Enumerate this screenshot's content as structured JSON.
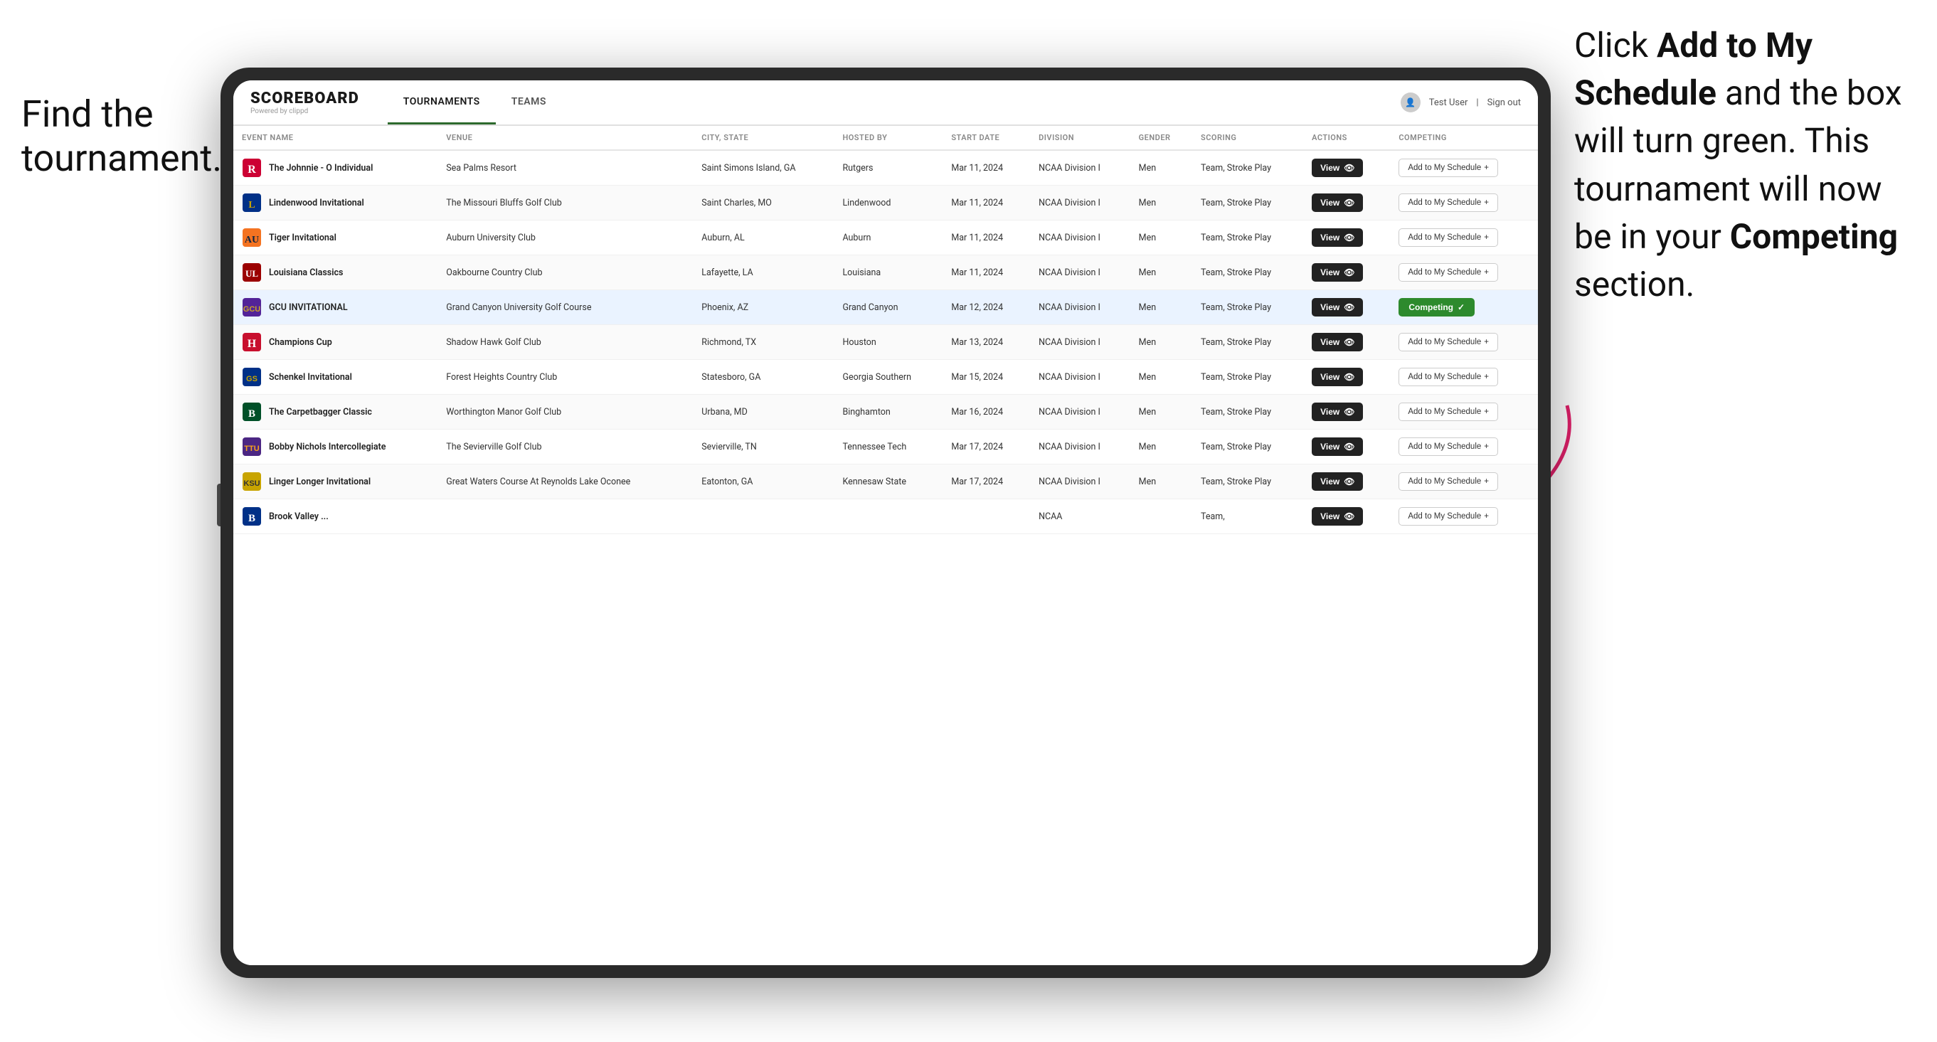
{
  "annotations": {
    "left": "Find the\ntournament.",
    "right_line1": "Click ",
    "right_bold1": "Add to My\nSchedule",
    "right_line2": " and the\nbox will turn green.\nThis tournament\nwill now be in\nyour ",
    "right_bold2": "Competing",
    "right_line3": "\nsection."
  },
  "navbar": {
    "logo": "SCOREBOARD",
    "logo_sub": "Powered by clippd",
    "tabs": [
      "TOURNAMENTS",
      "TEAMS"
    ],
    "active_tab": "TOURNAMENTS",
    "user": "Test User",
    "sign_out": "Sign out"
  },
  "table": {
    "columns": [
      "EVENT NAME",
      "VENUE",
      "CITY, STATE",
      "HOSTED BY",
      "START DATE",
      "DIVISION",
      "GENDER",
      "SCORING",
      "ACTIONS",
      "COMPETING"
    ],
    "rows": [
      {
        "logo": "🅁",
        "logo_color": "#c8102e",
        "event": "The Johnnie - O Individual",
        "venue": "Sea Palms Resort",
        "city_state": "Saint Simons Island, GA",
        "hosted_by": "Rutgers",
        "start_date": "Mar 11, 2024",
        "division": "NCAA Division I",
        "gender": "Men",
        "scoring": "Team, Stroke Play",
        "action": "View",
        "competing": "Add to My Schedule +",
        "is_competing": false,
        "highlighted": false
      },
      {
        "logo": "🦁",
        "logo_color": "#003087",
        "event": "Lindenwood Invitational",
        "venue": "The Missouri Bluffs Golf Club",
        "city_state": "Saint Charles, MO",
        "hosted_by": "Lindenwood",
        "start_date": "Mar 11, 2024",
        "division": "NCAA Division I",
        "gender": "Men",
        "scoring": "Team, Stroke Play",
        "action": "View",
        "competing": "Add to My Schedule +",
        "is_competing": false,
        "highlighted": false
      },
      {
        "logo": "🐯",
        "logo_color": "#f47321",
        "event": "Tiger Invitational",
        "venue": "Auburn University Club",
        "city_state": "Auburn, AL",
        "hosted_by": "Auburn",
        "start_date": "Mar 11, 2024",
        "division": "NCAA Division I",
        "gender": "Men",
        "scoring": "Team, Stroke Play",
        "action": "View",
        "competing": "Add to My Schedule +",
        "is_competing": false,
        "highlighted": false
      },
      {
        "logo": "⚜",
        "logo_color": "#8b0000",
        "event": "Louisiana Classics",
        "venue": "Oakbourne Country Club",
        "city_state": "Lafayette, LA",
        "hosted_by": "Louisiana",
        "start_date": "Mar 11, 2024",
        "division": "NCAA Division I",
        "gender": "Men",
        "scoring": "Team, Stroke Play",
        "action": "View",
        "competing": "Add to My Schedule +",
        "is_competing": false,
        "highlighted": false
      },
      {
        "logo": "⛰",
        "logo_color": "#522398",
        "event": "GCU INVITATIONAL",
        "venue": "Grand Canyon University Golf Course",
        "city_state": "Phoenix, AZ",
        "hosted_by": "Grand Canyon",
        "start_date": "Mar 12, 2024",
        "division": "NCAA Division I",
        "gender": "Men",
        "scoring": "Team, Stroke Play",
        "action": "View",
        "competing": "Competing ✓",
        "is_competing": true,
        "highlighted": true
      },
      {
        "logo": "⚙",
        "logo_color": "#c8102e",
        "event": "Champions Cup",
        "venue": "Shadow Hawk Golf Club",
        "city_state": "Richmond, TX",
        "hosted_by": "Houston",
        "start_date": "Mar 13, 2024",
        "division": "NCAA Division I",
        "gender": "Men",
        "scoring": "Team, Stroke Play",
        "action": "View",
        "competing": "Add to My Schedule +",
        "is_competing": false,
        "highlighted": false
      },
      {
        "logo": "🦅",
        "logo_color": "#003087",
        "event": "Schenkel Invitational",
        "venue": "Forest Heights Country Club",
        "city_state": "Statesboro, GA",
        "hosted_by": "Georgia Southern",
        "start_date": "Mar 15, 2024",
        "division": "NCAA Division I",
        "gender": "Men",
        "scoring": "Team, Stroke Play",
        "action": "View",
        "competing": "Add to My Schedule +",
        "is_competing": false,
        "highlighted": false
      },
      {
        "logo": "🅱",
        "logo_color": "#005eb8",
        "event": "The Carpetbagger Classic",
        "venue": "Worthington Manor Golf Club",
        "city_state": "Urbana, MD",
        "hosted_by": "Binghamton",
        "start_date": "Mar 16, 2024",
        "division": "NCAA Division I",
        "gender": "Men",
        "scoring": "Team, Stroke Play",
        "action": "View",
        "competing": "Add to My Schedule +",
        "is_competing": false,
        "highlighted": false
      },
      {
        "logo": "🏔",
        "logo_color": "#003087",
        "event": "Bobby Nichols Intercollegiate",
        "venue": "The Sevierville Golf Club",
        "city_state": "Sevierville, TN",
        "hosted_by": "Tennessee Tech",
        "start_date": "Mar 17, 2024",
        "division": "NCAA Division I",
        "gender": "Men",
        "scoring": "Team, Stroke Play",
        "action": "View",
        "competing": "Add to My Schedule +",
        "is_competing": false,
        "highlighted": false
      },
      {
        "logo": "🦉",
        "logo_color": "#c8b400",
        "event": "Linger Longer Invitational",
        "venue": "Great Waters Course At Reynolds Lake Oconee",
        "city_state": "Eatonton, GA",
        "hosted_by": "Kennesaw State",
        "start_date": "Mar 17, 2024",
        "division": "NCAA Division I",
        "gender": "Men",
        "scoring": "Team, Stroke Play",
        "action": "View",
        "competing": "Add to My Schedule +",
        "is_competing": false,
        "highlighted": false
      },
      {
        "logo": "🐻",
        "logo_color": "#003087",
        "event": "Brook Valley ...",
        "venue": "",
        "city_state": "",
        "hosted_by": "",
        "start_date": "",
        "division": "NCAA",
        "gender": "",
        "scoring": "Team,",
        "action": "View",
        "competing": "Add to My Schedule +",
        "is_competing": false,
        "highlighted": false
      }
    ]
  }
}
